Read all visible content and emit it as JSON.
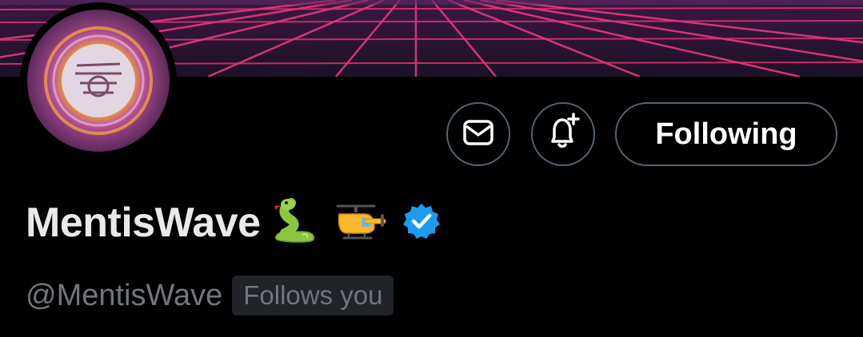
{
  "profile": {
    "display_name": "MentisWave",
    "handle": "@MentisWave",
    "follows_you_label": "Follows you",
    "name_emojis": [
      "snake-emoji",
      "helicopter-emoji"
    ],
    "verified": true
  },
  "actions": {
    "message_icon": "mail-icon",
    "notify_icon": "bell-plus-icon",
    "following_label": "Following"
  },
  "colors": {
    "background": "#000000",
    "button_border": "#536471",
    "verified_blue": "#1d9bf0",
    "muted_text": "#71767b",
    "banner_grid": "#e0357a"
  }
}
